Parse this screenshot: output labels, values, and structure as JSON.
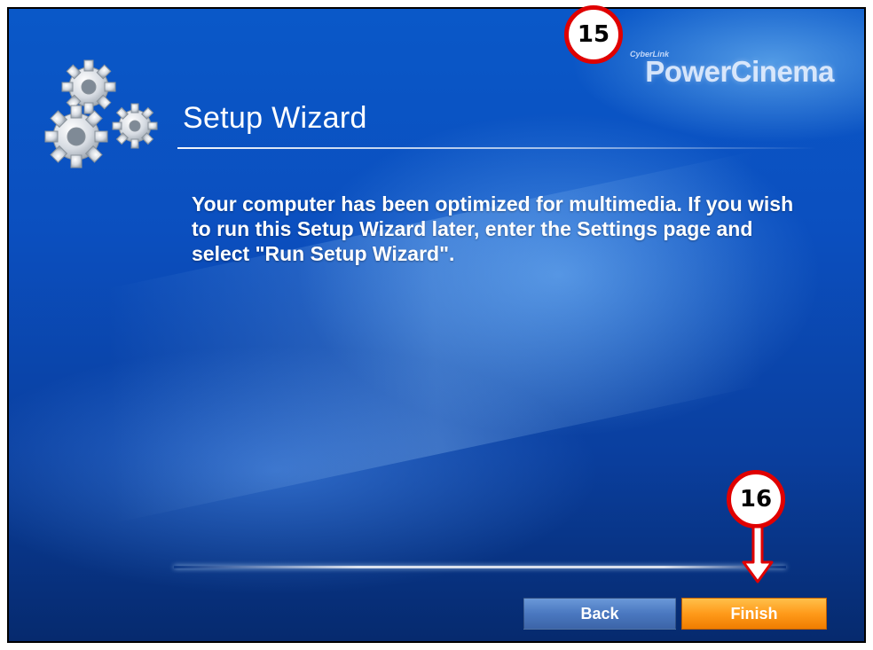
{
  "brand": {
    "small_label": "CyberLink",
    "logo_text": "PowerCinema"
  },
  "wizard": {
    "title": "Setup Wizard",
    "message": "Your computer has been optimized for multimedia. If you wish to run this Setup Wizard later, enter the Settings page and select \"Run Setup Wizard\"."
  },
  "buttons": {
    "back_label": "Back",
    "finish_label": "Finish"
  },
  "annotations": {
    "callout_logo": "15",
    "callout_finish": "16"
  },
  "colors": {
    "background_blue": "#0a4fbf",
    "finish_orange": "#ff9a1a",
    "back_blue": "#4a78c0",
    "callout_red": "#e00000"
  },
  "icons": {
    "gears": "settings-gears-icon",
    "arrow": "arrow-down-icon"
  }
}
